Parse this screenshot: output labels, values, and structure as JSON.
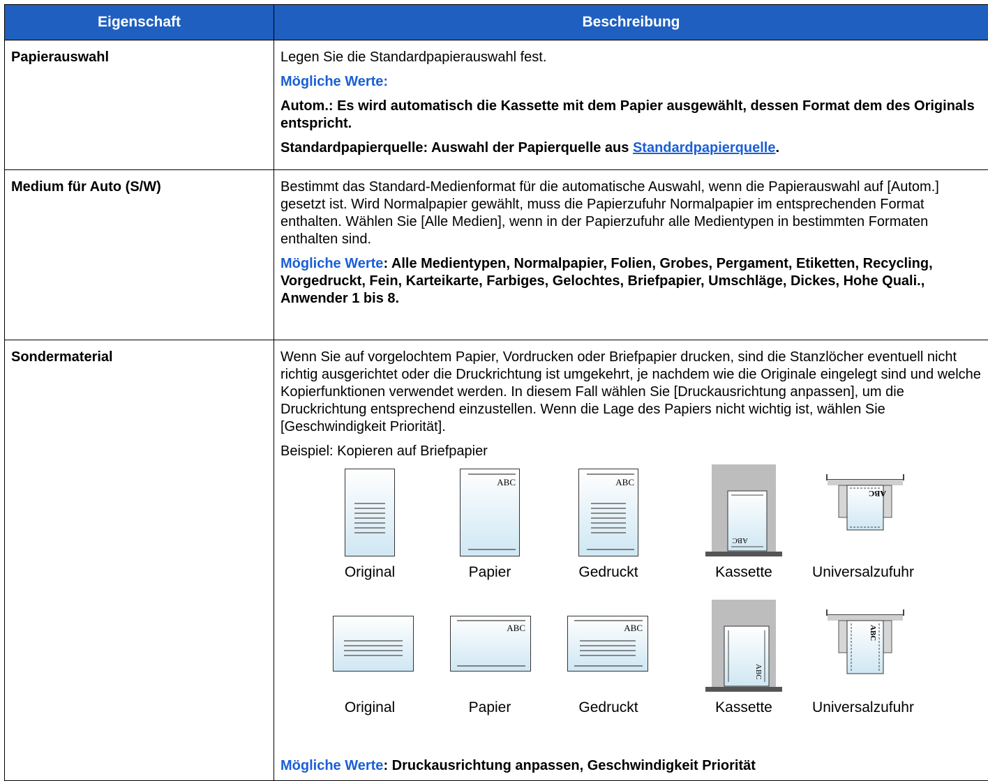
{
  "header": {
    "col1": "Eigenschaft",
    "col2": "Beschreibung"
  },
  "rows": [
    {
      "property": "Papierauswahl",
      "text": "Legen Sie die Standardpapierauswahl fest.",
      "values_label": "Mögliche Werte:",
      "opt1": "Autom.: Es wird automatisch die Kassette mit dem Papier ausgewählt, dessen Format dem des Originals entspricht.",
      "opt2_pre": "Standardpapierquelle: Auswahl der Papierquelle aus ",
      "opt2_link": "Standardpapierquelle",
      "opt2_post": "."
    },
    {
      "property": "Medium für Auto (S/W)",
      "text": "Bestimmt das Standard-Medienformat für die automatische Auswahl, wenn die Papierauswahl auf [Autom.] gesetzt ist. Wird Normalpapier gewählt, muss die Papierzufuhr Normalpapier im entsprechenden Format enthalten. Wählen Sie [Alle Medien], wenn in der Papierzufuhr alle Medientypen in bestimmten Formaten enthalten sind.",
      "values_label": "Mögliche Werte",
      "values": ": Alle Medientypen, Normalpapier, Folien, Grobes, Pergament, Etiketten, Recycling, Vorgedruckt, Fein, Karteikarte, Farbiges, Gelochtes, Briefpapier, Umschläge, Dickes, Hohe Quali., Anwender 1 bis 8."
    },
    {
      "property": "Sondermaterial",
      "text": "Wenn Sie auf vorgelochtem Papier, Vordrucken oder Briefpapier drucken, sind die Stanzlöcher eventuell nicht richtig ausgerichtet oder die Druckrichtung ist umgekehrt, je nachdem wie die Originale eingelegt sind und welche Kopierfunktionen verwendet werden. In diesem Fall wählen Sie [Druckausrichtung anpassen], um die Druckrichtung entsprechend einzustellen. Wenn die Lage des Papiers nicht wichtig ist, wählen Sie [Geschwindigkeit Priorität].",
      "example": "Beispiel: Kopieren auf Briefpapier",
      "captions": [
        "Original",
        "Papier",
        "Gedruckt",
        "Kassette",
        "Universalzufuhr"
      ],
      "abc": "ABC",
      "values_label": "Mögliche Werte",
      "values": ": Druckausrichtung anpassen, Geschwindigkeit Priorität"
    }
  ]
}
